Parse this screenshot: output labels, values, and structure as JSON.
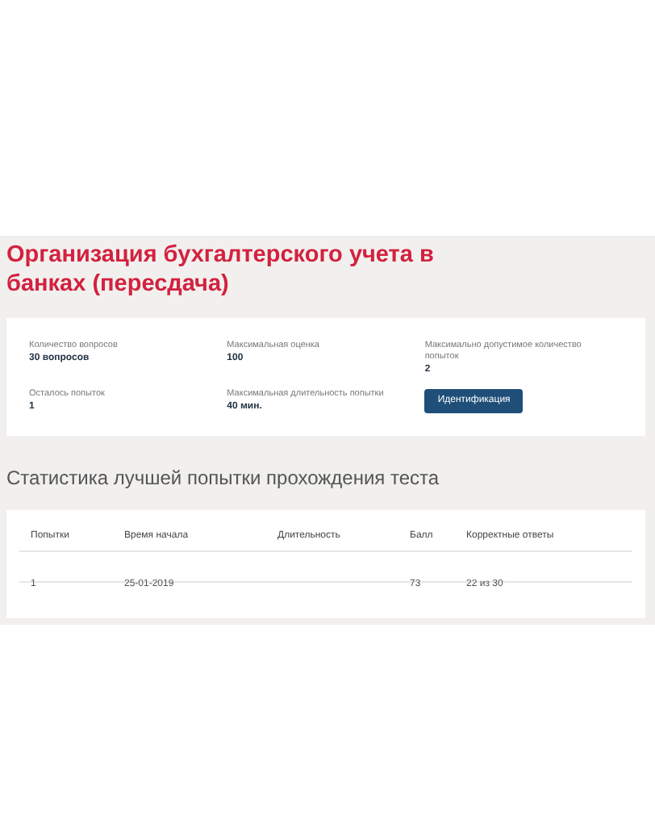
{
  "title": "Организация бухгалтерского учета в банках (пересдача)",
  "info": [
    {
      "label": "Количество вопросов",
      "value": "30 вопросов",
      "kind": "field"
    },
    {
      "label": "Максимальная оценка",
      "value": "100",
      "kind": "field"
    },
    {
      "label": "Максимально допустимое количество попыток",
      "value": "2",
      "kind": "field"
    },
    {
      "label": "Осталось попыток",
      "value": "1",
      "kind": "field"
    },
    {
      "label": "Максимальная длительность попытки",
      "value": "40 мин.",
      "kind": "field"
    },
    {
      "label": "Идентификация",
      "kind": "button"
    }
  ],
  "stats": {
    "heading": "Статистика лучшей попытки прохождения теста",
    "columns": [
      "Попытки",
      "Время начала",
      "Длительность",
      "Балл",
      "Корректные ответы"
    ],
    "rows": [
      [
        "1",
        "25-01-2019",
        "",
        "73",
        "22 из 30"
      ]
    ]
  }
}
